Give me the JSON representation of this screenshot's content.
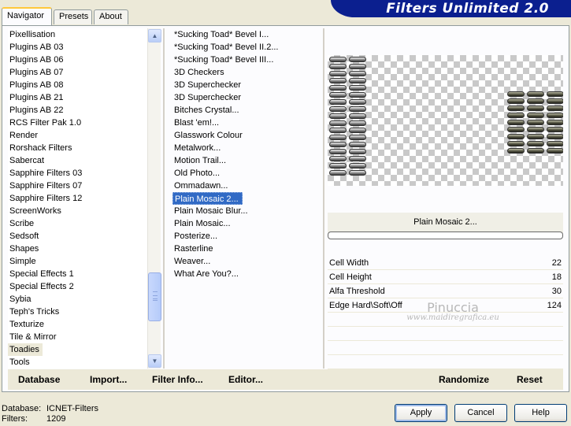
{
  "tabs": [
    "Navigator",
    "Presets",
    "About"
  ],
  "banner": "Filters Unlimited 2.0",
  "categories": [
    "Pixellisation",
    "Plugins AB 03",
    "Plugins AB 06",
    "Plugins AB 07",
    "Plugins AB 08",
    "Plugins AB 21",
    "Plugins AB 22",
    "RCS Filter Pak 1.0",
    "Render",
    "Rorshack Filters",
    "Sabercat",
    "Sapphire Filters 03",
    "Sapphire Filters 07",
    "Sapphire Filters 12",
    "ScreenWorks",
    "Scribe",
    "Sedsoft",
    "Shapes",
    "Simple",
    "Special Effects 1",
    "Special Effects 2",
    "Sybia",
    "Teph's Tricks",
    "Texturize",
    "Tile & Mirror",
    "Toadies",
    "Tools"
  ],
  "selected_category": "Toadies",
  "filters": [
    "*Sucking Toad*  Bevel I...",
    "*Sucking Toad*  Bevel II.2...",
    "*Sucking Toad*  Bevel III...",
    "3D Checkers",
    "3D Superchecker",
    "3D Superchecker",
    "Bitches Crystal...",
    "Blast 'em!...",
    "Glasswork Colour",
    "Metalwork...",
    "Motion Trail...",
    "Old Photo...",
    "Ommadawn...",
    "Plain Mosaic 2...",
    "Plain Mosaic Blur...",
    "Plain Mosaic...",
    "Posterize...",
    "Rasterline",
    "Weaver...",
    "What Are You?..."
  ],
  "selected_filter": "Plain Mosaic 2...",
  "filter_name": "Plain Mosaic 2...",
  "params": [
    {
      "label": "Cell Width",
      "value": "22"
    },
    {
      "label": "Cell Height",
      "value": "18"
    },
    {
      "label": "Alfa Threshold",
      "value": "30"
    },
    {
      "label": "Edge Hard\\Soft\\Off",
      "value": "124"
    }
  ],
  "watermark": {
    "line1": "Pinuccia",
    "line2": "www.maidiregrafica.eu"
  },
  "bottom": {
    "database": "Database",
    "import": "Import...",
    "filter_info": "Filter Info...",
    "editor": "Editor...",
    "randomize": "Randomize",
    "reset": "Reset"
  },
  "status": {
    "database_label": "Database:",
    "database_value": "ICNET-Filters",
    "filters_label": "Filters:",
    "filters_value": "1209"
  },
  "buttons": {
    "apply": "Apply",
    "cancel": "Cancel",
    "help": "Help"
  }
}
